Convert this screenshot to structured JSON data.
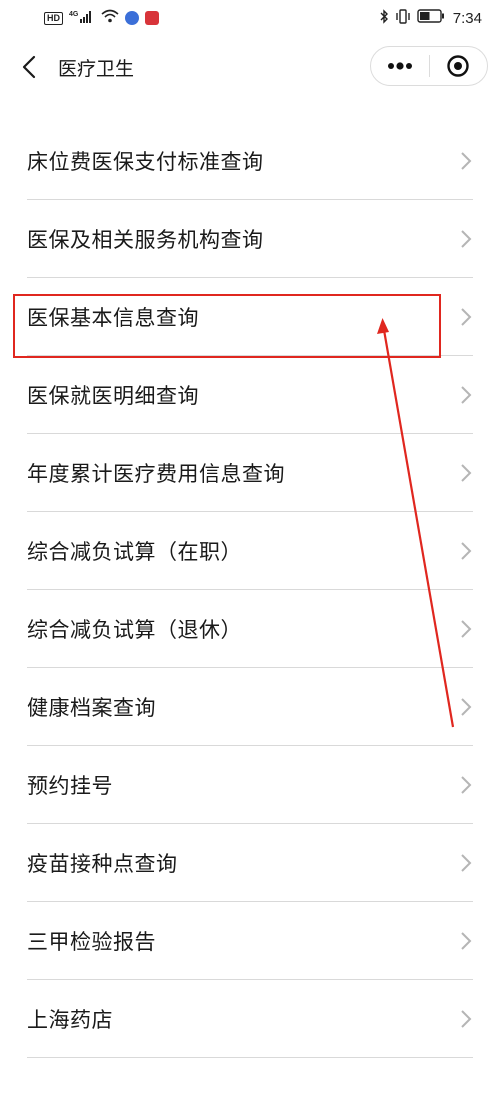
{
  "status_bar": {
    "hd": "HD",
    "network": "4G",
    "time": "7:34",
    "battery_level": 0.5,
    "icons": [
      "signal-icon",
      "wifi-icon",
      "music-app-icon",
      "book-app-icon",
      "bluetooth-icon",
      "vibrate-icon",
      "battery-icon"
    ]
  },
  "nav": {
    "title": "医疗卫生",
    "back_icon": "chevron-left-icon",
    "more_icon": "more-dots-icon",
    "close_icon": "target-close-icon"
  },
  "menu": {
    "items": [
      {
        "label": "床位费医保支付标准查询"
      },
      {
        "label": "医保及相关服务机构查询"
      },
      {
        "label": "医保基本信息查询"
      },
      {
        "label": "医保就医明细查询"
      },
      {
        "label": "年度累计医疗费用信息查询"
      },
      {
        "label": "综合减负试算（在职）"
      },
      {
        "label": "综合减负试算（退休）"
      },
      {
        "label": "健康档案查询"
      },
      {
        "label": "预约挂号"
      },
      {
        "label": "疫苗接种点查询"
      },
      {
        "label": "三甲检验报告"
      },
      {
        "label": "上海药店"
      }
    ]
  },
  "annotation": {
    "color": "#e0271f",
    "highlighted_item": "医保基本信息查询"
  }
}
